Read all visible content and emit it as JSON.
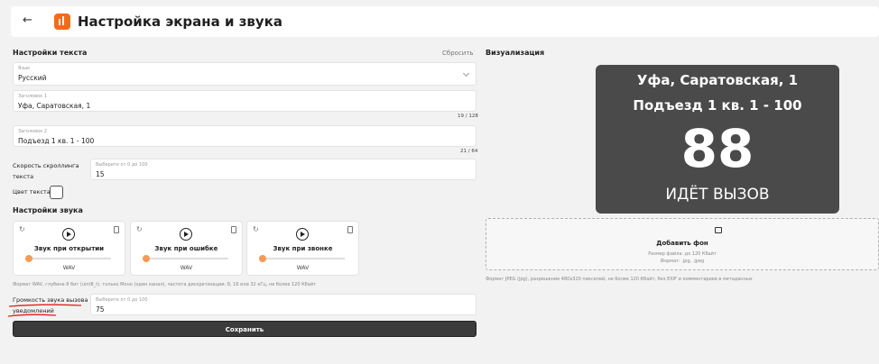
{
  "header": {
    "back_icon": "←",
    "title": "Настройка экрана и звука"
  },
  "text_settings": {
    "title": "Настройки текста",
    "reset_label": "Сбросить",
    "language": {
      "label": "Язык",
      "value": "Русский"
    },
    "heading1": {
      "label": "Заголовок 1",
      "value": "Уфа, Саратовская, 1",
      "counter": "19 / 128"
    },
    "heading2": {
      "label": "Заголовок 2",
      "value": "Подъезд 1 кв. 1 - 100",
      "counter": "21 / 64"
    },
    "scroll_speed": {
      "side_label_1": "Скорость скроллинга",
      "side_label_2": "текста",
      "label": "Выберите от 0 до 100",
      "value": "15"
    },
    "text_color_label": "Цвет текста"
  },
  "sound_settings": {
    "title": "Настройки звука",
    "cards": [
      {
        "name": "Звук при открытии",
        "format": "WAV"
      },
      {
        "name": "Звук при ошибке",
        "format": "WAV"
      },
      {
        "name": "Звук при звонке",
        "format": "WAV"
      }
    ],
    "format_hint": "Формат WAV, глубина 8 бит (uint8_t), только Моно (один канал), частота дискретизации: 8, 16 или 32 кГц, не более 120 Кбайт",
    "volume": {
      "side_label_1": "Громкость звука вызова и",
      "side_label_2": "уведомлений",
      "label": "Выберите от 0 до 100",
      "value": "75"
    },
    "slider_level": 0
  },
  "save_label": "Сохранить",
  "visualization": {
    "title": "Визуализация",
    "line1": "Уфа, Саратовская, 1",
    "line2": "Подъезд 1 кв. 1 - 100",
    "number": "88",
    "status": "ИДЁТ ВЫЗОВ"
  },
  "background_upload": {
    "title": "Добавить фон",
    "size_hint": "Размер файла: до 120 Кбайт",
    "format_hint": "Формат: .jpg, .jpeg",
    "requirements": "Формат JPEG (jpg), разрешение 480x320 пикселей, не более 120 Кбайт, без EXIF и комментариев в метаданных"
  },
  "colors": {
    "accent": "#f26b1d",
    "preview_bg": "#4a4a4a",
    "button_bg": "#3b3b3b",
    "annotation": "#e02020"
  }
}
